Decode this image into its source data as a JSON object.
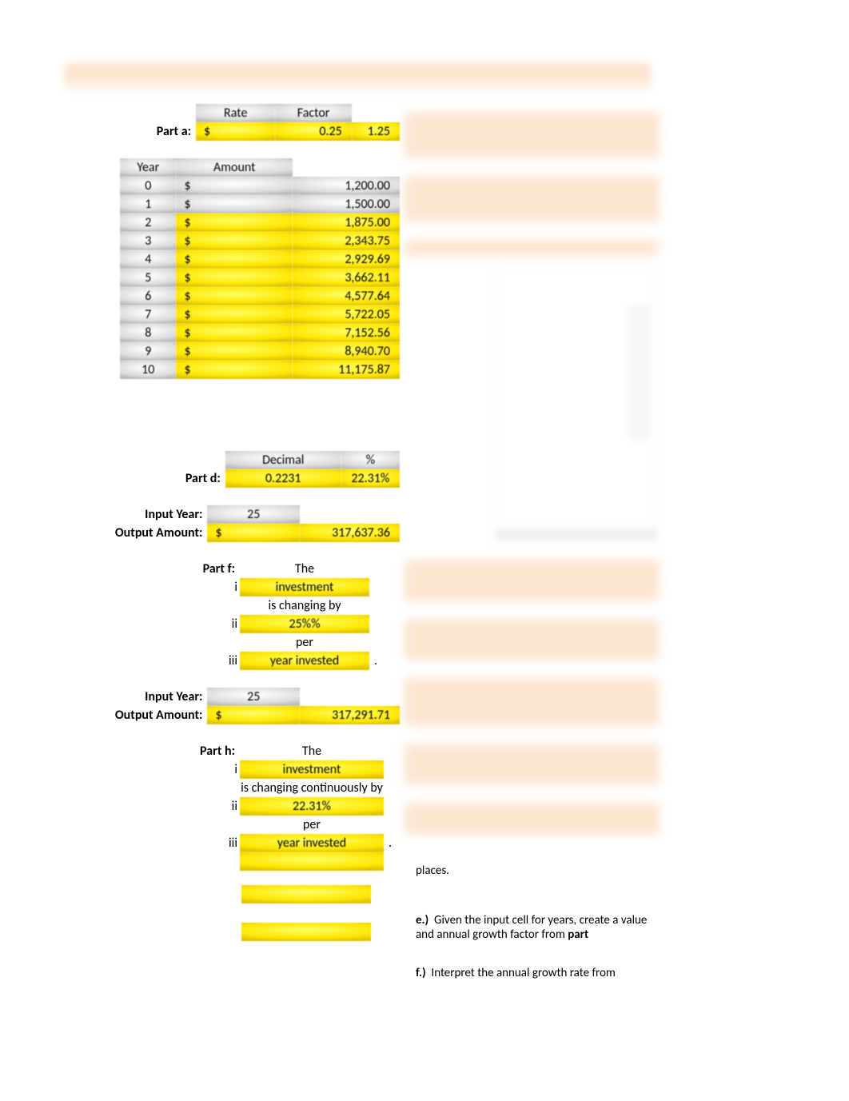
{
  "header": {
    "rate_label": "Rate",
    "factor_label": "Factor"
  },
  "part_a": {
    "label": "Part a:",
    "rate_dollar": "$",
    "rate_value": "0.25",
    "factor_value": "1.25"
  },
  "year_table": {
    "year_header": "Year",
    "amount_header": "Amount",
    "rows": [
      {
        "year": "0",
        "dollar": "$",
        "amount": "1,200.00"
      },
      {
        "year": "1",
        "dollar": "$",
        "amount": "1,500.00"
      },
      {
        "year": "2",
        "dollar": "$",
        "amount": "1,875.00"
      },
      {
        "year": "3",
        "dollar": "$",
        "amount": "2,343.75"
      },
      {
        "year": "4",
        "dollar": "$",
        "amount": "2,929.69"
      },
      {
        "year": "5",
        "dollar": "$",
        "amount": "3,662.11"
      },
      {
        "year": "6",
        "dollar": "$",
        "amount": "4,577.64"
      },
      {
        "year": "7",
        "dollar": "$",
        "amount": "5,722.05"
      },
      {
        "year": "8",
        "dollar": "$",
        "amount": "7,152.56"
      },
      {
        "year": "9",
        "dollar": "$",
        "amount": "8,940.70"
      },
      {
        "year": "10",
        "dollar": "$",
        "amount": "11,175.87"
      }
    ]
  },
  "part_d": {
    "decimal_label": "Decimal",
    "percent_label": "%",
    "label": "Part d:",
    "decimal_value": "0.2231",
    "percent_value": "22.31%"
  },
  "input1": {
    "year_label": "Input Year:",
    "year_value": "25",
    "amount_label": "Output Amount:",
    "amount_dollar": "$",
    "amount_value": "317,637.36"
  },
  "part_f": {
    "label": "Part f:",
    "the": "The",
    "i": "i",
    "i_val": "investment",
    "mid1": "is changing by",
    "ii": "ii",
    "ii_val": "25%%",
    "mid2": "per",
    "iii": "iii",
    "iii_val": "year invested",
    "period": "."
  },
  "input2": {
    "year_label": "Input Year:",
    "year_value": "25",
    "amount_label": "Output Amount:",
    "amount_dollar": "$",
    "amount_value": "317,291.71"
  },
  "part_h": {
    "label": "Part h:",
    "the": "The",
    "i": "i",
    "i_val": "investment",
    "mid1": "is changing continuously by",
    "ii": "ii",
    "ii_val": "22.31%",
    "mid2": "per",
    "iii": "iii",
    "iii_val": "year invested",
    "period": "."
  },
  "right_text": {
    "places": "places.",
    "e_label": "e.)",
    "e_text": "Given the input cell for years, create a value and annual growth factor from ",
    "e_bold": "part",
    "f_label": "f.)",
    "f_text": "Interpret the annual growth rate from"
  }
}
